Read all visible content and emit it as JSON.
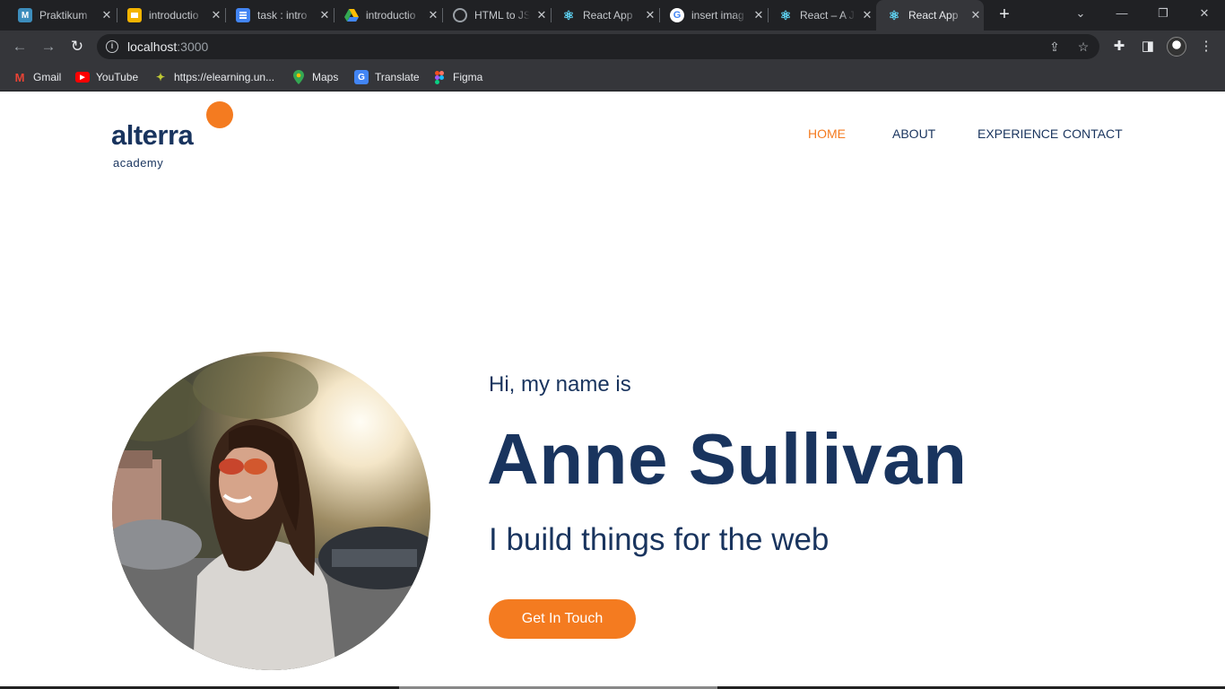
{
  "browser": {
    "tabs": [
      {
        "title": "Praktikum",
        "icon": "m-icon",
        "color": "#3c8dbc",
        "glyph": "M"
      },
      {
        "title": "introductio",
        "icon": "slides-icon",
        "color": "#f4b400",
        "glyph": ""
      },
      {
        "title": "task : intro",
        "icon": "docs-icon",
        "color": "#4285f4",
        "glyph": ""
      },
      {
        "title": "introductio",
        "icon": "drive-icon",
        "color": "#34a853",
        "glyph": ""
      },
      {
        "title": "HTML to JS",
        "icon": "globe-icon",
        "color": "#9aa0a6",
        "glyph": ""
      },
      {
        "title": "React App",
        "icon": "react-icon",
        "color": "#61dafb",
        "glyph": "⚛"
      },
      {
        "title": "insert imag",
        "icon": "google-icon",
        "color": "#ffffff",
        "glyph": "G"
      },
      {
        "title": "React – A J",
        "icon": "react-icon",
        "color": "#61dafb",
        "glyph": "⚛"
      },
      {
        "title": "React App",
        "icon": "react-icon",
        "color": "#61dafb",
        "glyph": "⚛"
      }
    ],
    "url_host": "localhost",
    "url_port": ":3000",
    "bookmarks": [
      {
        "label": "Gmail",
        "icon": "gmail-icon",
        "color": "#ea4335",
        "glyph": "M"
      },
      {
        "label": "YouTube",
        "icon": "youtube-icon",
        "color": "#ff0000",
        "glyph": "▶"
      },
      {
        "label": "https://elearning.un...",
        "icon": "elearning-icon",
        "color": "#8bc34a",
        "glyph": "✦"
      },
      {
        "label": "Maps",
        "icon": "maps-icon",
        "color": "#34a853",
        "glyph": "●"
      },
      {
        "label": "Translate",
        "icon": "translate-icon",
        "color": "#4285f4",
        "glyph": "G"
      },
      {
        "label": "Figma",
        "icon": "figma-icon",
        "color": "#f24e1e",
        "glyph": "F"
      }
    ]
  },
  "site": {
    "logo_word": "alterra",
    "logo_sub": "academy",
    "nav": [
      {
        "label": "HOME",
        "active": true
      },
      {
        "label": "ABOUT",
        "active": false
      },
      {
        "label": "EXPERIENCE",
        "active": false
      },
      {
        "label": "CONTACT",
        "active": false
      }
    ],
    "hero": {
      "greeting": "Hi, my name is",
      "name": "Anne Sullivan",
      "tagline": "I build things for the web",
      "cta_label": "Get In Touch"
    },
    "colors": {
      "primary": "#19345e",
      "accent": "#f47b20"
    }
  }
}
